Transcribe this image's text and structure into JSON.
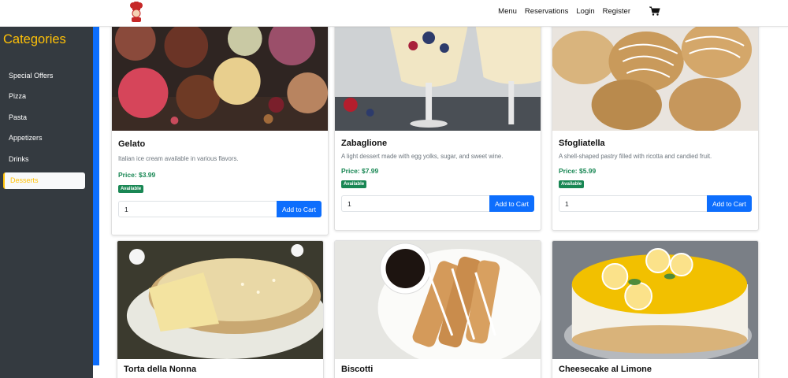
{
  "nav": {
    "links": [
      "Menu",
      "Reservations",
      "Login",
      "Register"
    ],
    "cart_icon": "shopping-cart-icon",
    "logo_icon": "chef-logo-icon"
  },
  "sidebar": {
    "title": "Categories",
    "items": [
      {
        "label": "Special Offers",
        "active": false
      },
      {
        "label": "Pizza",
        "active": false
      },
      {
        "label": "Pasta",
        "active": false
      },
      {
        "label": "Appetizers",
        "active": false
      },
      {
        "label": "Drinks",
        "active": false
      },
      {
        "label": "Desserts",
        "active": true
      }
    ]
  },
  "products": [
    {
      "name": "Gelato",
      "description": "Italian ice cream available in various flavors.",
      "price": "Price: $3.99",
      "status": "Available",
      "quantity": "1",
      "button": "Add to Cart"
    },
    {
      "name": "Zabaglione",
      "description": "A light dessert made with egg yolks, sugar, and sweet wine.",
      "price": "Price: $7.99",
      "status": "Available",
      "quantity": "1",
      "button": "Add to Cart"
    },
    {
      "name": "Sfogliatella",
      "description": "A shell-shaped pastry filled with ricotta and candied fruit.",
      "price": "Price: $5.99",
      "status": "Available",
      "quantity": "1",
      "button": "Add to Cart"
    },
    {
      "name": "Torta della Nonna"
    },
    {
      "name": "Biscotti"
    },
    {
      "name": "Cheesecake al Limone"
    }
  ],
  "colors": {
    "accent": "#0d6efd",
    "sidebar_bg": "#343a40",
    "sidebar_title": "#ffc107",
    "price": "#198754"
  }
}
